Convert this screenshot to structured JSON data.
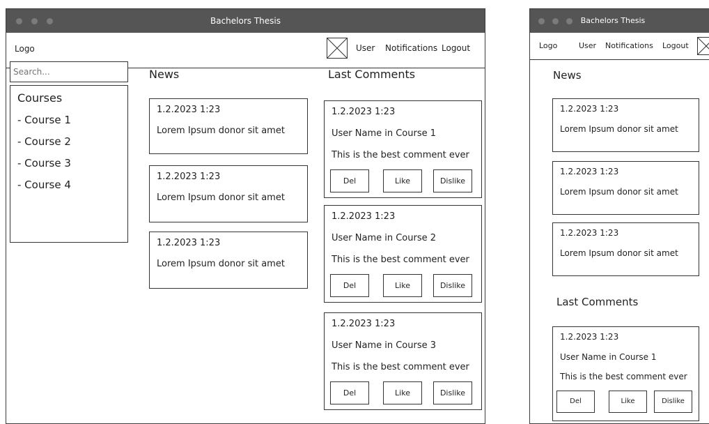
{
  "window": {
    "title": "Bachelors Thesis"
  },
  "header": {
    "logo": "Logo",
    "user": "User",
    "notifications": "Notifications",
    "logout": "Logout"
  },
  "search": {
    "placeholder": "Search..."
  },
  "courses": {
    "title": "Courses",
    "items": [
      "- Course 1",
      "- Course 2",
      "- Course 3",
      "- Course 4"
    ]
  },
  "news": {
    "title": "News",
    "items": [
      {
        "date": "1.2.2023 1:23",
        "text": "Lorem Ipsum donor sit amet"
      },
      {
        "date": "1.2.2023 1:23",
        "text": "Lorem Ipsum donor sit amet"
      },
      {
        "date": "1.2.2023 1:23",
        "text": "Lorem Ipsum donor sit amet"
      }
    ]
  },
  "comments": {
    "title": "Last Comments",
    "buttons": {
      "del": "Del",
      "like": "Like",
      "dislike": "Dislike"
    },
    "items": [
      {
        "date": "1.2.2023 1:23",
        "user": "User Name in Course 1",
        "text": "This is the best comment ever"
      },
      {
        "date": "1.2.2023 1:23",
        "user": "User Name in Course 2",
        "text": "This is the best comment ever"
      },
      {
        "date": "1.2.2023 1:23",
        "user": "User Name in Course 3",
        "text": "This is the best comment ever"
      }
    ]
  },
  "icons": {
    "image_placeholder": "image-placeholder-icon",
    "window_controls": "window-dot-icon"
  },
  "colors": {
    "titlebar": "#555555",
    "border": "#333333",
    "background": "#ffffff"
  }
}
